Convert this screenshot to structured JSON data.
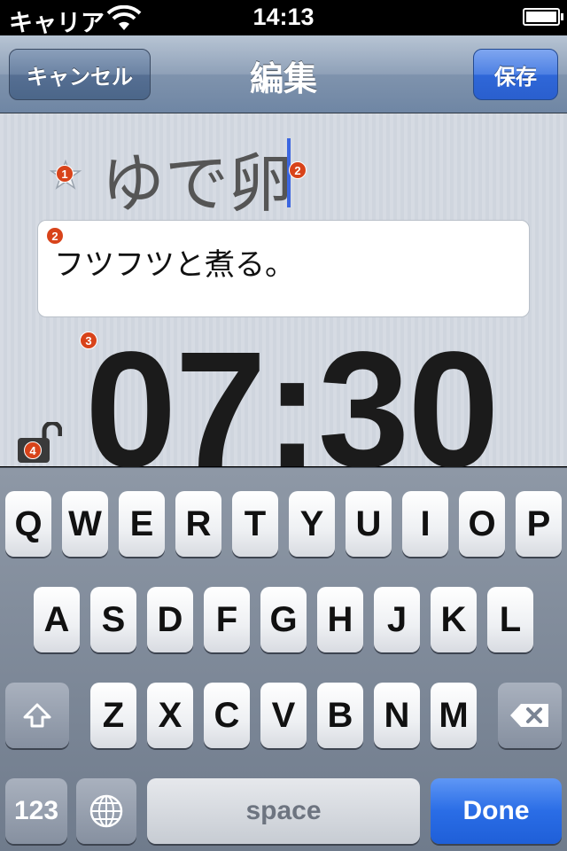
{
  "status_bar": {
    "carrier": "キャリア",
    "time": "14:13"
  },
  "nav": {
    "cancel_label": "キャンセル",
    "title": "編集",
    "save_label": "保存"
  },
  "editor": {
    "title_text": "ゆで卵",
    "note_text": "フツフツと煮る。",
    "timer_text": "07:30",
    "badges": [
      "1",
      "2",
      "2",
      "3",
      "4"
    ]
  },
  "keyboard": {
    "row1": [
      "Q",
      "W",
      "E",
      "R",
      "T",
      "Y",
      "U",
      "I",
      "O",
      "P"
    ],
    "row2": [
      "A",
      "S",
      "D",
      "F",
      "G",
      "H",
      "J",
      "K",
      "L"
    ],
    "row3": [
      "Z",
      "X",
      "C",
      "V",
      "B",
      "N",
      "M"
    ],
    "numbers_label": "123",
    "space_label": "space",
    "done_label": "Done"
  },
  "colors": {
    "accent": "#2a6de6",
    "badge": "#d8431a",
    "cursor": "#3b66e0"
  }
}
